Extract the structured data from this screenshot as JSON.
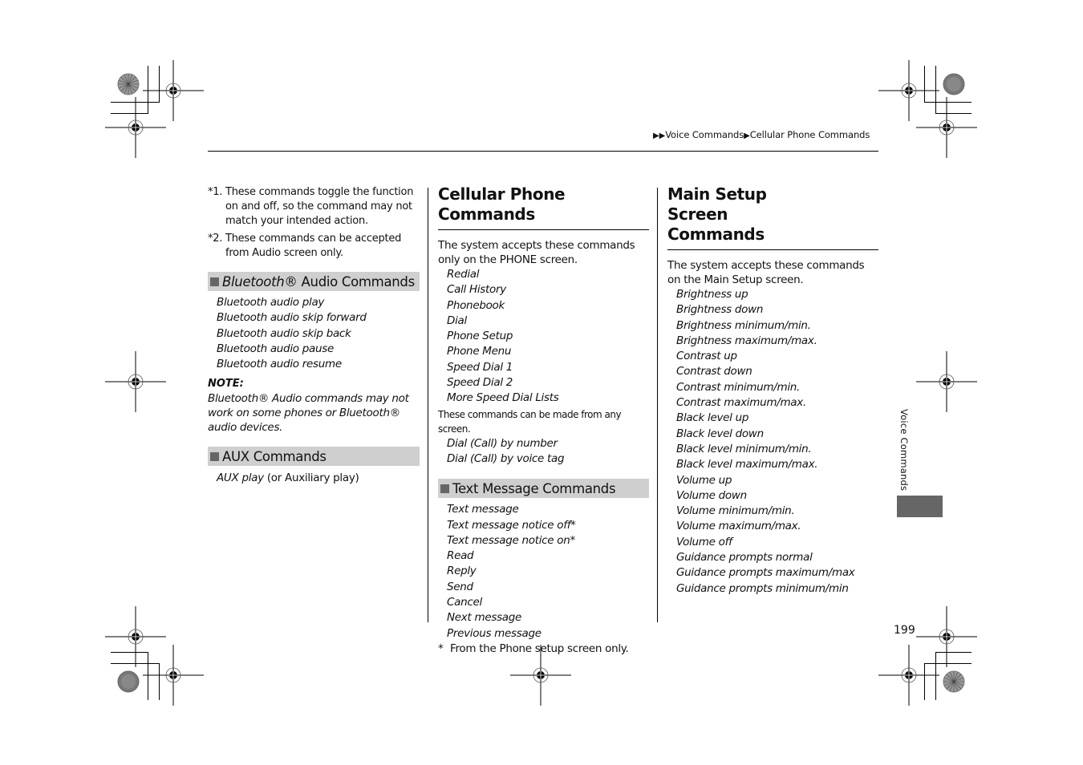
{
  "header": {
    "breadcrumb": {
      "arrows": "▶▶",
      "level1": "Voice Commands",
      "separator": "▶",
      "level2": "Cellular Phone Commands"
    }
  },
  "left_column": {
    "footnotes": [
      {
        "mark": "*1.",
        "text": "These commands toggle the function on and off, so the command may not match your intended action."
      },
      {
        "mark": "*2.",
        "text": "These commands can be accepted from Audio screen only."
      }
    ],
    "bluetooth_section": {
      "title_italic": "Bluetooth",
      "title_rest": "® Audio Commands",
      "commands": [
        "Bluetooth audio play",
        "Bluetooth audio skip forward",
        "Bluetooth audio skip back",
        "Bluetooth audio pause",
        "Bluetooth audio resume"
      ],
      "note_label": "NOTE:",
      "note_text": "Bluetooth® Audio commands may not work on some phones or Bluetooth® audio devices."
    },
    "aux_section": {
      "title": "AUX Commands",
      "command_italic": "AUX play",
      "command_rest": " (or Auxiliary play)"
    }
  },
  "middle_column": {
    "title": "Cellular Phone Commands",
    "intro": "The system accepts these commands only on the PHONE screen.",
    "phone_commands": [
      "Redial",
      "Call History",
      "Phonebook",
      "Dial",
      "Phone Setup",
      "Phone Menu",
      "Speed Dial 1",
      "Speed Dial 2",
      "More Speed Dial Lists"
    ],
    "any_screen_note": "These commands can be made from any screen.",
    "any_screen_commands": [
      "Dial (Call) by number",
      "Dial (Call) by voice tag"
    ],
    "text_message_section": {
      "title": "Text Message Commands",
      "commands": [
        "Text message",
        "Text message notice off*",
        "Text message notice on*",
        "Read",
        "Reply",
        "Send",
        "Cancel",
        "Next message",
        "Previous message"
      ],
      "footnote_mark": "*",
      "footnote_text": "From the Phone setup screen only."
    }
  },
  "right_column": {
    "title": "Main Setup Screen Commands",
    "intro": "The system accepts these commands on the Main Setup screen.",
    "commands": [
      "Brightness up",
      "Brightness down",
      "Brightness minimum/min.",
      "Brightness maximum/max.",
      "Contrast up",
      "Contrast down",
      "Contrast minimum/min.",
      "Contrast maximum/max.",
      "Black level up",
      "Black level down",
      "Black level minimum/min.",
      "Black level maximum/max.",
      "Volume up",
      "Volume down",
      "Volume minimum/min.",
      "Volume maximum/max.",
      "Volume off",
      "Guidance prompts normal",
      "Guidance prompts maximum/max",
      "Guidance prompts minimum/min"
    ]
  },
  "side_tab": {
    "label": "Voice Commands"
  },
  "footer": {
    "page_number": "199"
  },
  "colors": {
    "section_bar": "#cfcfcf",
    "section_square": "#666666",
    "side_tab": "#666666",
    "text": "#111111"
  }
}
